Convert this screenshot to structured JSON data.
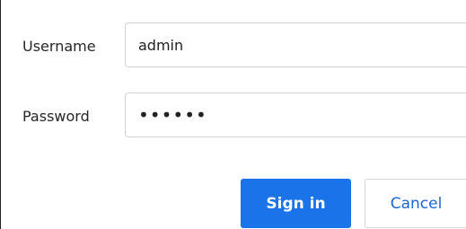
{
  "form": {
    "username_label": "Username",
    "username_value": "admin",
    "password_label": "Password",
    "password_value": "••••••",
    "signin_label": "Sign in",
    "cancel_label": "Cancel"
  },
  "colors": {
    "primary": "#1a73e8",
    "link_text": "#1967d2",
    "border": "#d2d2d2"
  }
}
